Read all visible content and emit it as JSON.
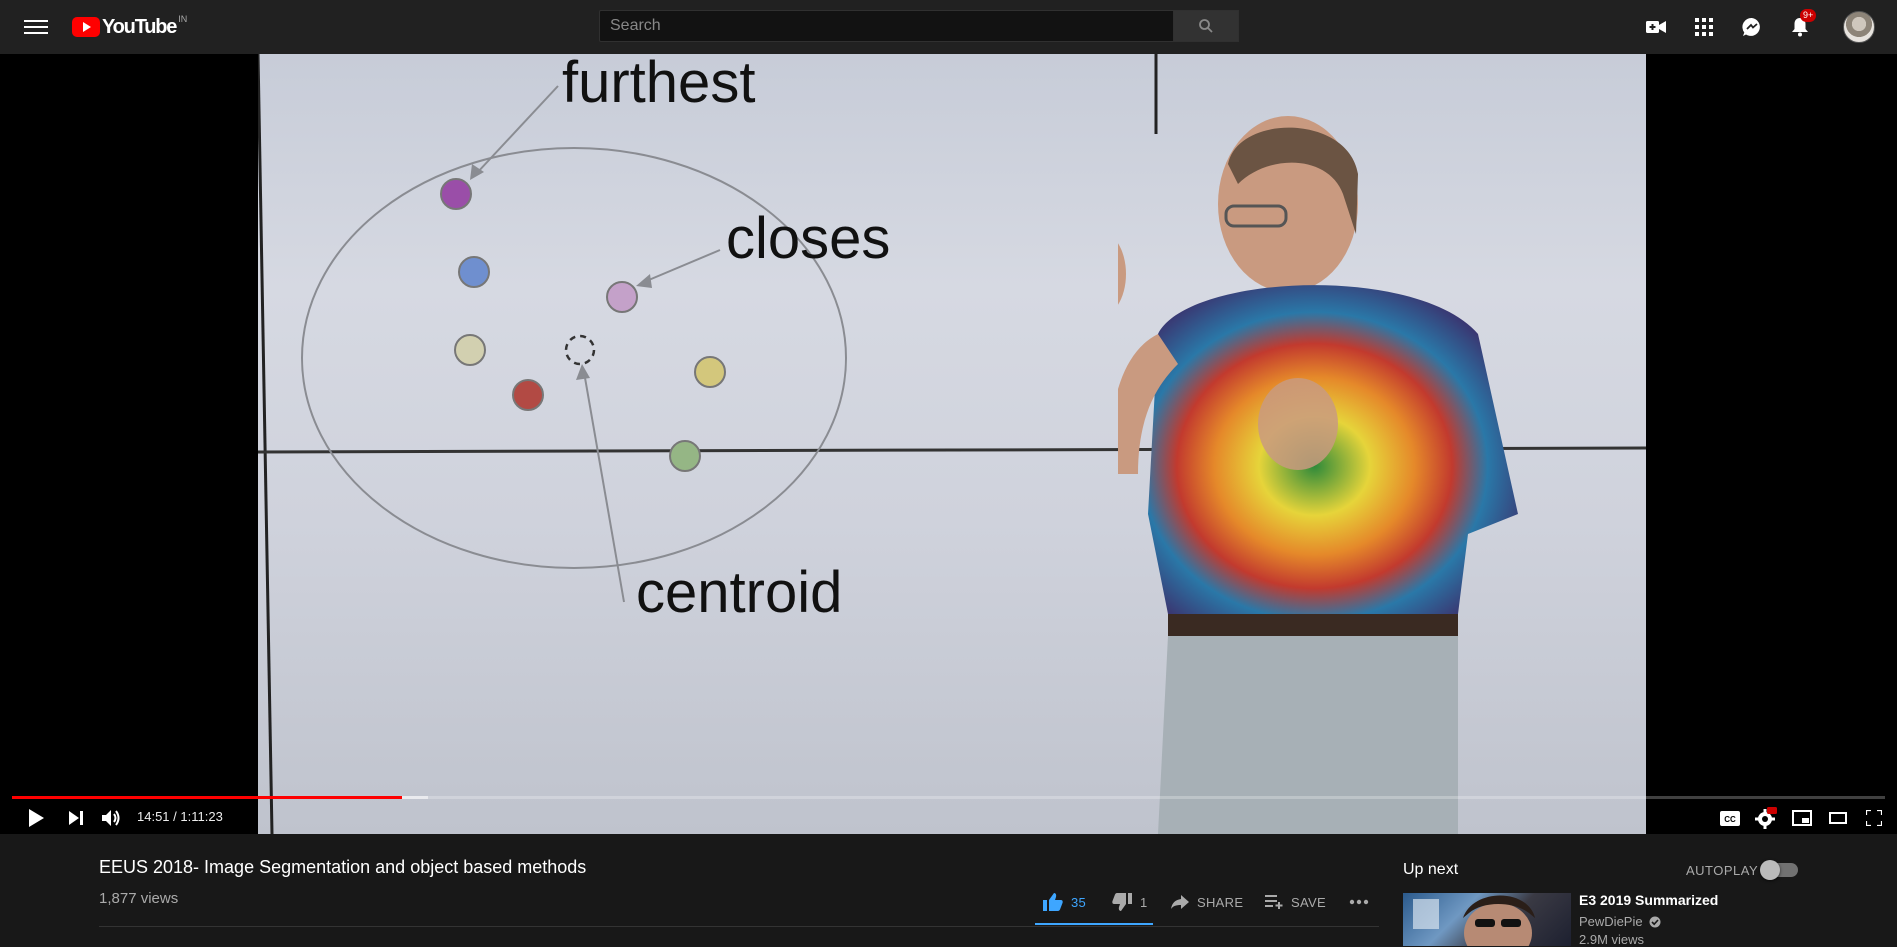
{
  "masthead": {
    "logo_text": "YouTube",
    "country_code": "IN",
    "search_placeholder": "Search",
    "notification_count": "9+"
  },
  "video": {
    "slide_labels": {
      "furthest": "furthest",
      "closest": "closes",
      "centroid": "centroid"
    },
    "current_time": "14:51",
    "separator": " / ",
    "duration": "1:11:23",
    "played_fraction": 0.208,
    "buffered_fraction": 0.222
  },
  "info": {
    "title": "EEUS 2018- Image Segmentation and object based methods",
    "views": "1,877 views",
    "likes": "35",
    "dislikes": "1",
    "share_label": "SHARE",
    "save_label": "SAVE"
  },
  "sidebar": {
    "up_next_label": "Up next",
    "autoplay_label": "AUTOPLAY",
    "rec": {
      "title": "E3 2019 Summarized",
      "channel": "PewDiePie",
      "views": "2.9M views"
    }
  },
  "colors": {
    "accent_red": "#ff0000",
    "like_blue": "#3ea6ff",
    "background": "#181818"
  }
}
